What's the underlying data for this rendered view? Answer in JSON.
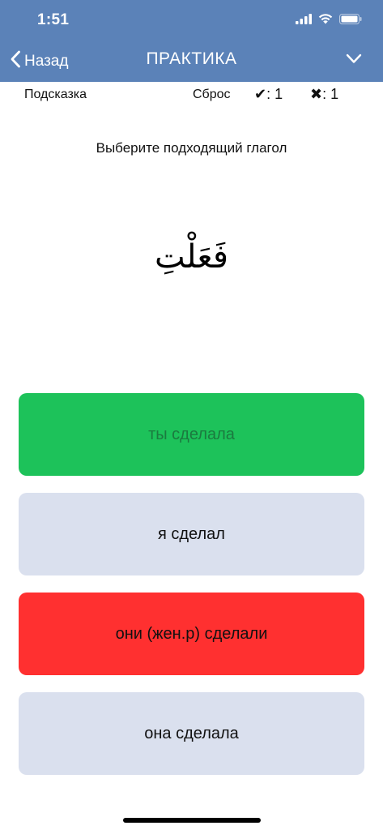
{
  "status_bar": {
    "time": "1:51"
  },
  "nav": {
    "back_label": "Назад",
    "title": "ПРАКТИКА"
  },
  "toolbar": {
    "hint_label": "Подсказка",
    "reset_label": "Сброс",
    "correct_symbol": "✔",
    "correct_count": ": 1",
    "wrong_symbol": "✖",
    "wrong_count": ": 1"
  },
  "question": {
    "prompt": "Выберите подходящий глагол",
    "word": "فَعَلْتِ"
  },
  "answers": [
    {
      "label": "ты сделала",
      "state": "correct"
    },
    {
      "label": "я сделал",
      "state": "neutral"
    },
    {
      "label": "они (жен.р) сделали",
      "state": "wrong"
    },
    {
      "label": "она сделала",
      "state": "neutral"
    }
  ],
  "colors": {
    "header": "#5b82b8",
    "correct": "#1dc25a",
    "wrong": "#ff3030",
    "neutral": "#dae0ee"
  },
  "icons": {
    "back": "chevron-left-icon",
    "menu": "chevron-down-icon",
    "signal": "signal-icon",
    "wifi": "wifi-icon",
    "battery": "battery-icon"
  }
}
